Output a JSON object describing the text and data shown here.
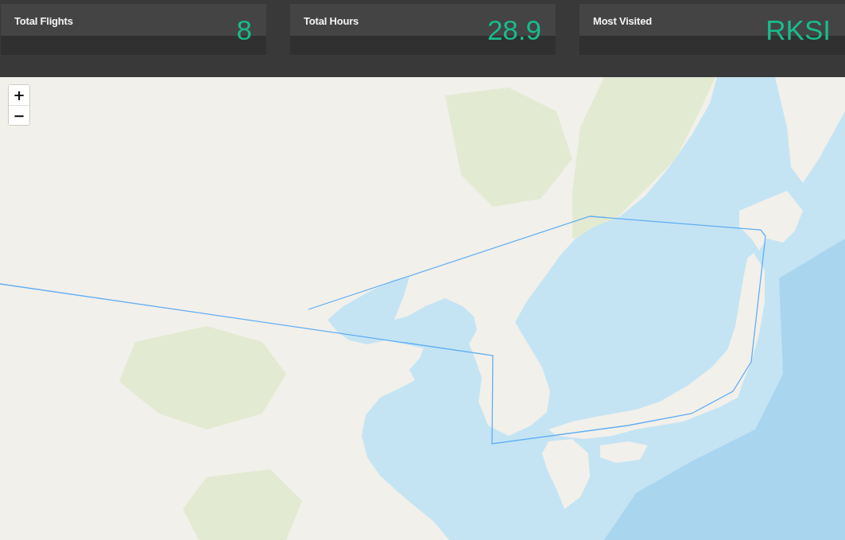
{
  "stats": [
    {
      "label": "Total Flights",
      "value": "8"
    },
    {
      "label": "Total Hours",
      "value": "28.9"
    },
    {
      "label": "Most Visited",
      "value": "RKSI"
    }
  ],
  "map": {
    "zoom_controls": [
      "+",
      "−"
    ]
  }
}
